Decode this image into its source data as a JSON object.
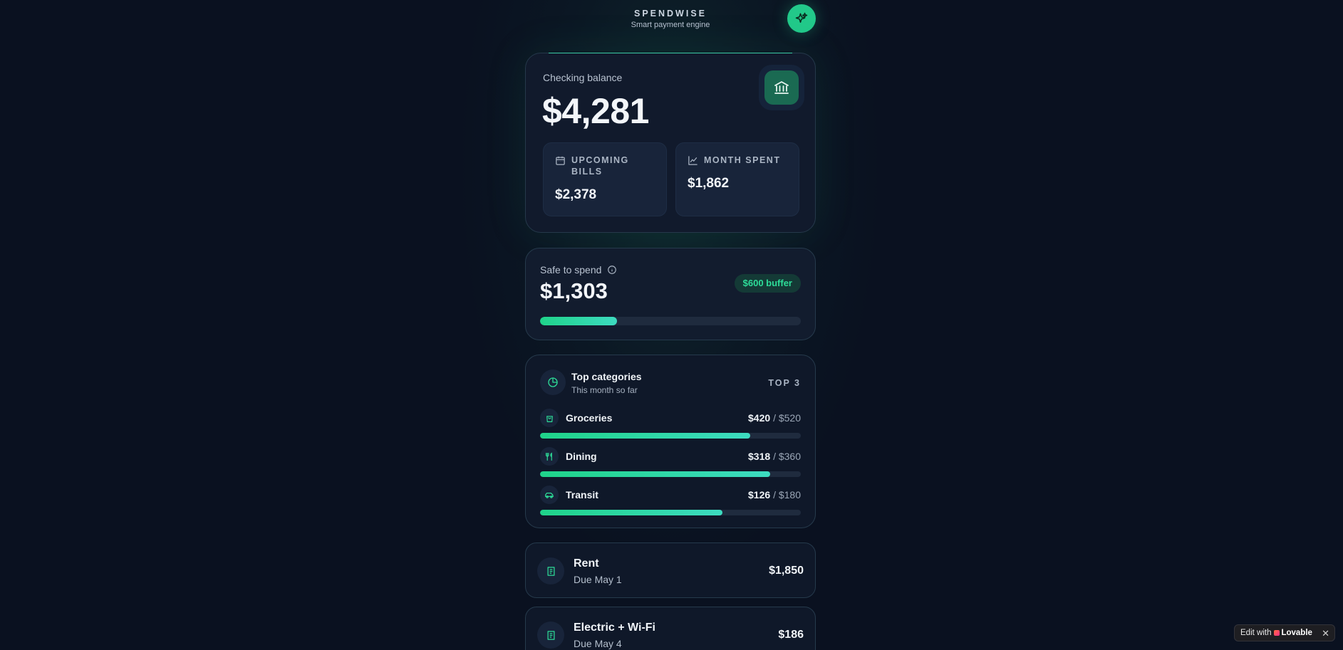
{
  "header": {
    "brand": "SPENDWISE",
    "tagline": "Smart payment engine",
    "action_icon": "sparkles-icon"
  },
  "balance": {
    "label": "Checking balance",
    "amount": "$4,281",
    "icon": "bank-icon",
    "upcoming_bills": {
      "label": "UPCOMING BILLS",
      "value": "$2,378",
      "icon": "calendar-icon"
    },
    "month_spent": {
      "label": "MONTH SPENT",
      "value": "$1,862",
      "icon": "line-chart-icon"
    }
  },
  "safe_to_spend": {
    "label": "Safe to spend",
    "amount": "$1,303",
    "buffer": "$600 buffer",
    "progress_percent": 29.5
  },
  "categories": {
    "title": "Top categories",
    "subtitle": "This month so far",
    "tag": "TOP 3",
    "items": [
      {
        "name": "Groceries",
        "spent": "$420",
        "budget": "/ $520",
        "fraction": 0.807,
        "icon": "shopping-bag-icon"
      },
      {
        "name": "Dining",
        "spent": "$318",
        "budget": "/ $360",
        "fraction": 0.883,
        "icon": "utensils-icon"
      },
      {
        "name": "Transit",
        "spent": "$126",
        "budget": "/ $180",
        "fraction": 0.7,
        "icon": "car-icon"
      }
    ]
  },
  "bills": [
    {
      "name": "Rent",
      "due": "Due May 1",
      "amount": "$1,850",
      "icon": "receipt-icon"
    },
    {
      "name": "Electric + Wi-Fi",
      "due": "Due May 4",
      "amount": "$186",
      "icon": "receipt-icon"
    }
  ],
  "badge": {
    "prefix": "Edit with",
    "brand": "Lovable",
    "close": "✕"
  },
  "colors": {
    "background": "#0a1120",
    "accent": "#22c98a",
    "card": "#111a2c"
  }
}
